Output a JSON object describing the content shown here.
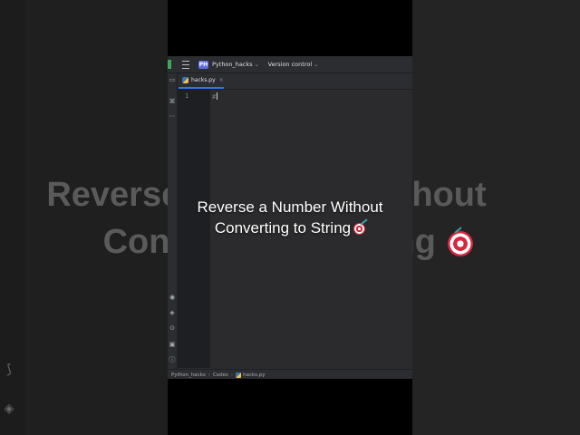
{
  "background": {
    "caption_line1": "Reverse a Number Without",
    "caption_line2": "Converting to String",
    "left_icons": [
      "python-icon",
      "layers-icon"
    ]
  },
  "titlebar": {
    "project_badge": "PH",
    "project_name": "Python_hacks",
    "vcs_label": "Version control",
    "chevron": "⌄"
  },
  "tab": {
    "label": "hacks.py",
    "close": "×"
  },
  "editor": {
    "line_number": "1",
    "code_text": "#"
  },
  "statusbar": {
    "breadcrumb": [
      "Python_hacks",
      "Codes",
      "hacks.py"
    ],
    "separator": "›"
  },
  "caption": {
    "line1": "Reverse a Number Without",
    "line2": "Converting to String"
  },
  "colors": {
    "accent": "#3574f0",
    "ide_bg": "#2b2d30",
    "editor_bg": "#1e1f22"
  }
}
